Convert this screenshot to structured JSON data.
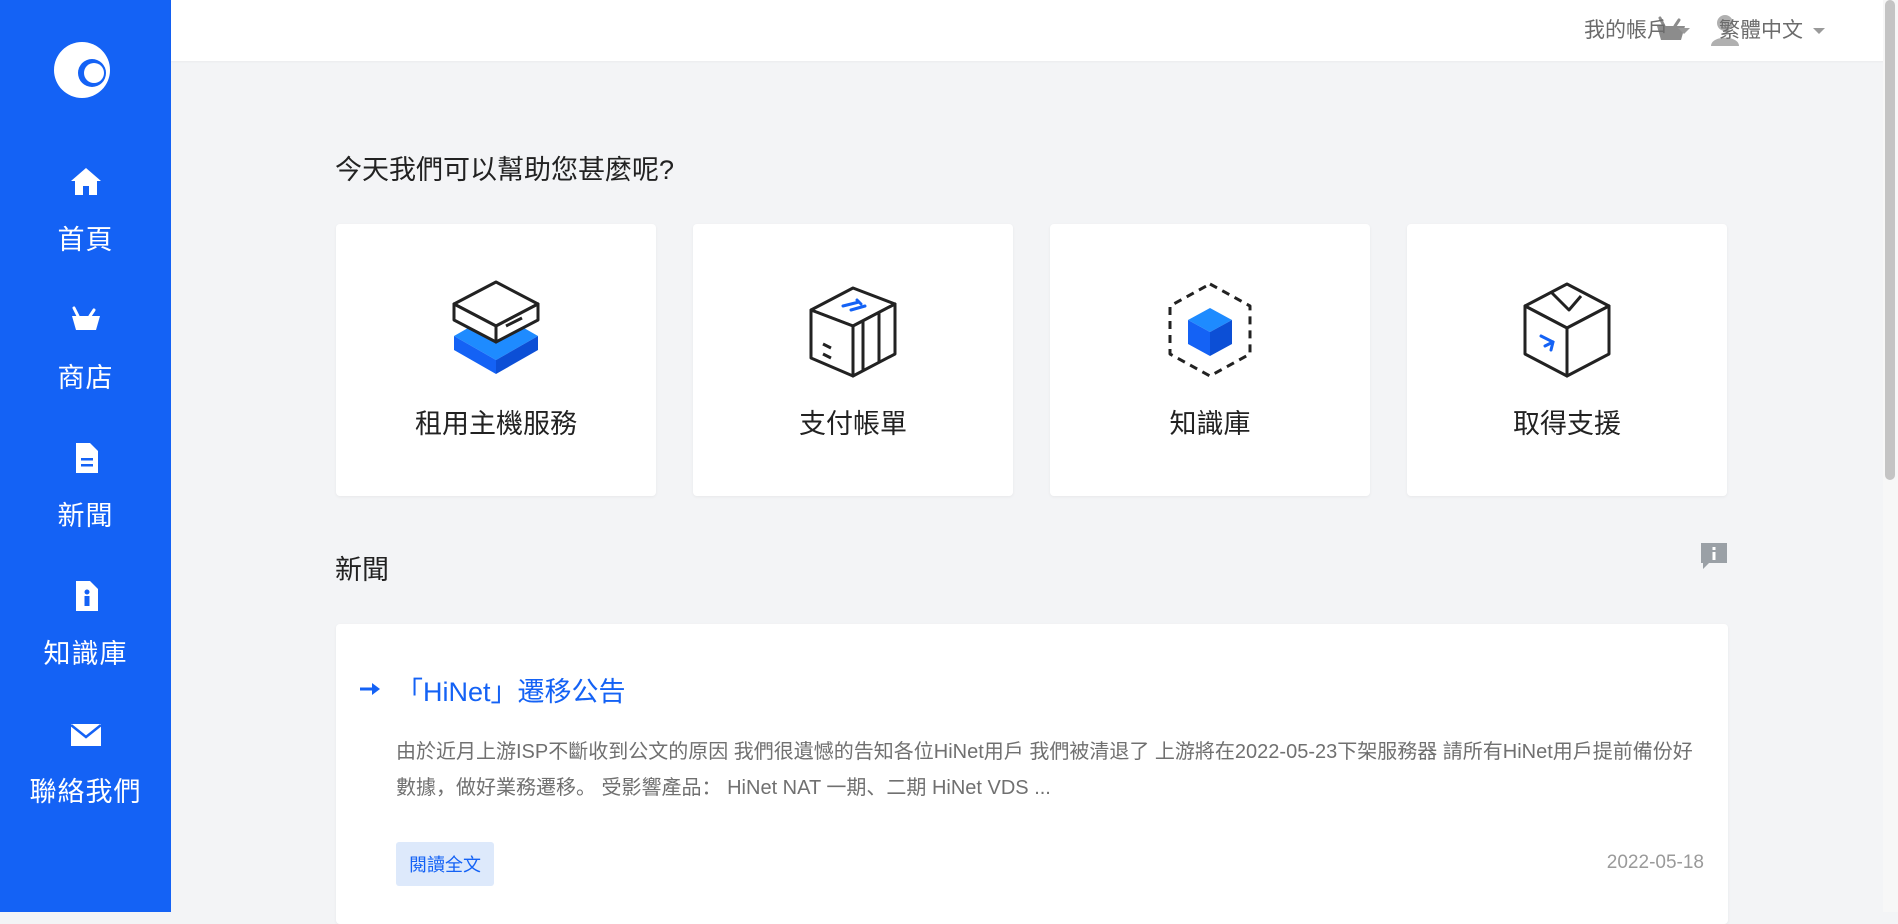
{
  "sidebar": {
    "items": [
      {
        "label": "首頁",
        "icon": "home-icon"
      },
      {
        "label": "商店",
        "icon": "cart-icon"
      },
      {
        "label": "新聞",
        "icon": "document-icon"
      },
      {
        "label": "知識庫",
        "icon": "info-file-icon"
      },
      {
        "label": "聯絡我們",
        "icon": "envelope-icon"
      }
    ]
  },
  "topbar": {
    "account_label": "我的帳戶",
    "language_label": "繁體中文"
  },
  "main": {
    "heading": "今天我們可以幫助您甚麼呢?",
    "cards": [
      {
        "label": "租用主機服務",
        "icon": "server-icon"
      },
      {
        "label": "支付帳單",
        "icon": "payment-box-icon"
      },
      {
        "label": "知識庫",
        "icon": "cube-icon"
      },
      {
        "label": "取得支援",
        "icon": "support-box-icon"
      }
    ],
    "news_heading": "新聞"
  },
  "news": {
    "title": "「HiNet」遷移公告",
    "body": "由於近月上游ISP不斷收到公文的原因 我們很遺憾的告知各位HiNet用戶 我們被清退了   上游將在2022-05-23下架服務器 請所有HiNet用戶提前備份好數據，做好業務遷移。   受影響產品： HiNet NAT 一期、二期 HiNet VDS ...",
    "read_more": "閱讀全文",
    "date": "2022-05-18"
  },
  "colors": {
    "accent": "#1462f5",
    "background": "#f3f4f6"
  }
}
